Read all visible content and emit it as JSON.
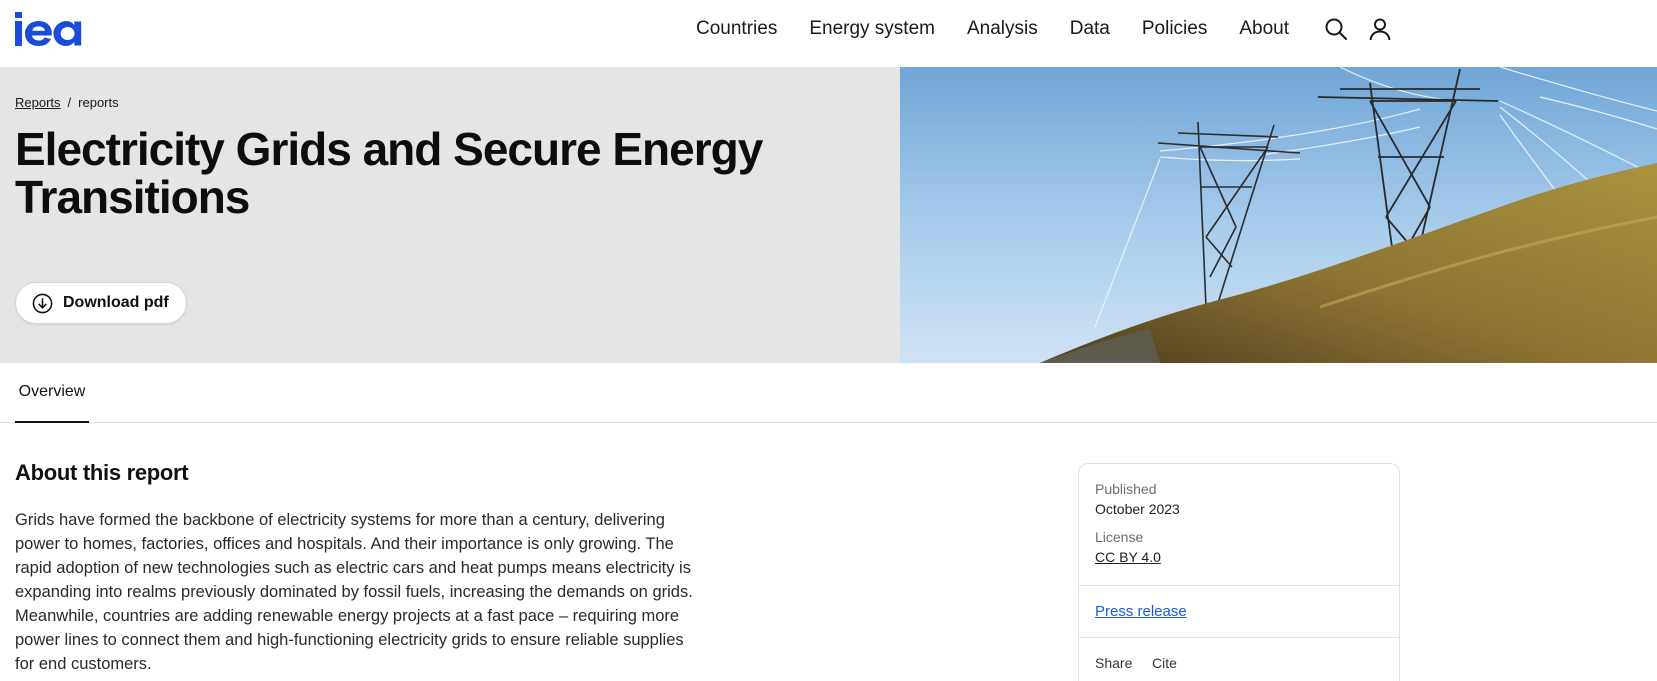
{
  "brand": {
    "logo_text": "iea",
    "color": "#1a4cd9"
  },
  "nav": {
    "items": [
      {
        "label": "Countries"
      },
      {
        "label": "Energy system"
      },
      {
        "label": "Analysis"
      },
      {
        "label": "Data"
      },
      {
        "label": "Policies"
      },
      {
        "label": "About"
      }
    ],
    "icons": [
      "search-icon",
      "user-icon"
    ]
  },
  "breadcrumb": {
    "parent": "Reports",
    "separator": "/",
    "current": "reports"
  },
  "hero": {
    "title": "Electricity Grids and Secure Energy Transitions",
    "download_label": "Download pdf",
    "download_icon": "download-icon",
    "image_subject": "power-pylons-on-grassy-hill"
  },
  "tabs": [
    {
      "label": "Overview",
      "active": true
    }
  ],
  "main": {
    "section_title": "About this report",
    "paragraph": "Grids have formed the backbone of electricity systems for more than a century, delivering power to homes, factories, offices and hospitals. And their importance is only growing. The rapid adoption of new technologies such as electric cars and heat pumps means electricity is expanding into realms previously dominated by fossil fuels, increasing the demands on grids. Meanwhile, countries are adding renewable energy projects at a fast pace – requiring more power lines to connect them and high-functioning electricity grids to ensure reliable supplies for end customers."
  },
  "sidebar": {
    "published_label": "Published",
    "published_value": "October 2023",
    "license_label": "License",
    "license_value": "CC BY 4.0",
    "press_release": "Press release",
    "share_label": "Share",
    "cite_label": "Cite",
    "link_color": "#1a5cd9"
  }
}
